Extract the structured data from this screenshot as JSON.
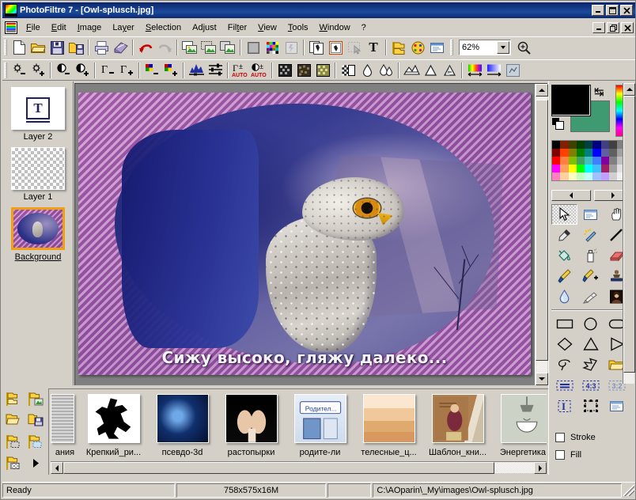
{
  "window": {
    "title": "PhotoFiltre 7 - [Owl-splusch.jpg]",
    "app_icon": "photofiltre-logo-icon",
    "minimize": "–",
    "maximize": "□",
    "close": "×",
    "mdi_restore": "❐"
  },
  "menu": {
    "items": [
      {
        "label": "File",
        "accel": "F"
      },
      {
        "label": "Edit",
        "accel": "E"
      },
      {
        "label": "Image",
        "accel": "I"
      },
      {
        "label": "Layer",
        "accel": "y"
      },
      {
        "label": "Selection",
        "accel": "S"
      },
      {
        "label": "Adjust",
        "accel": "j"
      },
      {
        "label": "Filter",
        "accel": "t"
      },
      {
        "label": "View",
        "accel": "V"
      },
      {
        "label": "Tools",
        "accel": "T"
      },
      {
        "label": "Window",
        "accel": "W"
      },
      {
        "label": "?",
        "accel": ""
      }
    ]
  },
  "toolbar_main": {
    "zoom_value": "62%",
    "buttons": [
      "new-document-icon",
      "open-folder-icon",
      "save-icon",
      "save-as-icon",
      "print-icon",
      "print-preview-icon",
      "undo-icon",
      "redo-icon",
      "copy-image-icon",
      "paste-as-layer-icon",
      "duplicate-image-icon",
      "grayscale-icon",
      "color-palette-icon",
      "transparency-icon",
      "crop-to-selection-icon",
      "framed-image-icon",
      "select-all-icon",
      "text-tool-icon",
      "layer-manager-icon",
      "color-wheel-icon",
      "module-window-icon",
      "zoom-in-icon"
    ]
  },
  "toolbar_adjust": {
    "buttons": [
      "brightness-down-icon",
      "brightness-up-icon",
      "contrast-down-icon",
      "contrast-up-icon",
      "gamma-down-icon",
      "gamma-up-icon",
      "color-saturation-down-icon",
      "color-saturation-up-icon",
      "histogram-icon",
      "levels-icon",
      "auto-gamma-icon",
      "auto-contrast-icon",
      "dither-bayer-icon",
      "dither-noise-icon",
      "dither-pattern-icon",
      "checkered-mask-icon",
      "blur-icon",
      "blur-more-icon",
      "sharpen-icon",
      "soften-icon",
      "emboss-icon",
      "gradient-spectrum-icon",
      "gradient-linear-icon",
      "texture-frame-icon"
    ]
  },
  "layers_panel": {
    "items": [
      {
        "label": "Layer 2",
        "thumb": "text-layer-thumb",
        "selected": false
      },
      {
        "label": "Layer 1",
        "thumb": "transparent-layer-thumb",
        "selected": false
      },
      {
        "label": "Background",
        "thumb": "owl-image-thumb",
        "selected": true
      }
    ],
    "ops": [
      "new-layer-icon",
      "layer-from-image-icon",
      "open-layer-icon",
      "save-layer-icon",
      "layer-from-selection-icon",
      "layer-mask-icon",
      "layer-transparency-icon",
      "more-layer-options-icon"
    ]
  },
  "canvas": {
    "overlay_text": "Сижу высоко, гляжу далеко...",
    "image_name": "Owl-splusch.jpg"
  },
  "right_panel": {
    "foreground_color": "#000000",
    "background_color": "#3f9a72",
    "swap_icon": "swap-colors-icon",
    "reset_icon": "reset-colors-icon",
    "hue_bar": "hue-spectrum-bar",
    "palette_prev": "◄",
    "palette_next": "►",
    "palette_colors": [
      "#000000",
      "#802000",
      "#404000",
      "#004000",
      "#004040",
      "#000080",
      "#404080",
      "#404040",
      "#808080",
      "#ffffff",
      "#800000",
      "#ff4000",
      "#808000",
      "#008000",
      "#008080",
      "#0000ff",
      "#6060a0",
      "#606060",
      "#a0a0a0",
      "#ffffff",
      "#ff0000",
      "#ff8040",
      "#80c000",
      "#40a060",
      "#40c0c0",
      "#4080ff",
      "#8000a0",
      "#808080",
      "#c0c0c0",
      "#ffffff",
      "#ff00ff",
      "#ffa060",
      "#ffff00",
      "#00ff00",
      "#00ffff",
      "#40c0ff",
      "#a02060",
      "#a0a0a0",
      "#e0e0e0",
      "#ffffff",
      "#ff80c0",
      "#ffd0a0",
      "#ffffc0",
      "#c0ffc0",
      "#c0ffff",
      "#a0c0ff",
      "#c0a0ff",
      "#d0d0d0",
      "#f0f0f0",
      "#ffffff"
    ],
    "tools": [
      {
        "name": "selection-arrow-tool",
        "active": true
      },
      {
        "name": "screen-capture-tool",
        "active": false
      },
      {
        "name": "hand-pan-tool",
        "active": false
      },
      {
        "name": "eyedropper-tool",
        "active": false
      },
      {
        "name": "magic-wand-tool",
        "active": false
      },
      {
        "name": "line-tool",
        "active": false
      },
      {
        "name": "fill-bucket-tool",
        "active": false
      },
      {
        "name": "airbrush-tool",
        "active": false
      },
      {
        "name": "eraser-tool",
        "active": false
      },
      {
        "name": "paintbrush-tool",
        "active": false
      },
      {
        "name": "advanced-brush-tool",
        "active": false
      },
      {
        "name": "stamp-tool",
        "active": false
      },
      {
        "name": "water-drop-tool",
        "active": false
      },
      {
        "name": "smudge-tool",
        "active": false
      },
      {
        "name": "clone-picture-tool",
        "active": false
      }
    ],
    "shapes": [
      {
        "name": "rectangle-shape"
      },
      {
        "name": "ellipse-shape"
      },
      {
        "name": "rounded-rectangle-shape"
      },
      {
        "name": "diamond-shape"
      },
      {
        "name": "triangle-shape"
      },
      {
        "name": "right-triangle-shape"
      },
      {
        "name": "lasso-shape"
      },
      {
        "name": "polygon-shape"
      },
      {
        "name": "open-shape-folder"
      },
      {
        "name": "aspect-free-icon"
      },
      {
        "name": "aspect-4-3-icon"
      },
      {
        "name": "aspect-3-2-icon"
      },
      {
        "name": "vector-text-icon"
      },
      {
        "name": "transform-handles-icon"
      },
      {
        "name": "shape-options-icon"
      }
    ],
    "aspect_labels": [
      "4:3",
      "3:2"
    ],
    "stroke_label": "Stroke",
    "stroke_checked": false,
    "fill_label": "Fill",
    "fill_checked": false
  },
  "browser": {
    "thumbnails": [
      {
        "caption": "ания",
        "kind": "grey-texture-thumb",
        "partial": true
      },
      {
        "caption": "Крепкий_ри...",
        "kind": "black-silhouette-thumb",
        "partial": false
      },
      {
        "caption": "псевдо-3d",
        "kind": "blue-noise-thumb",
        "partial": false
      },
      {
        "caption": "растопырки",
        "kind": "dark-hands-thumb",
        "partial": false
      },
      {
        "caption": "родите-ли",
        "kind": "blue-document-thumb",
        "partial": false
      },
      {
        "caption": "телесные_ц...",
        "kind": "skin-gradient-thumb",
        "partial": false
      },
      {
        "caption": "Шаблон_кни...",
        "kind": "book-template-thumb",
        "partial": false
      },
      {
        "caption": "Энергетика...",
        "kind": "lamp-thumb",
        "partial": false
      }
    ],
    "scroll_left": "◄",
    "scroll_right": "►"
  },
  "statusbar": {
    "message": "Ready",
    "dimensions": "758x575x16M",
    "extra": "",
    "path": "C:\\AOparin\\_My\\images\\Owl-splusch.jpg"
  }
}
